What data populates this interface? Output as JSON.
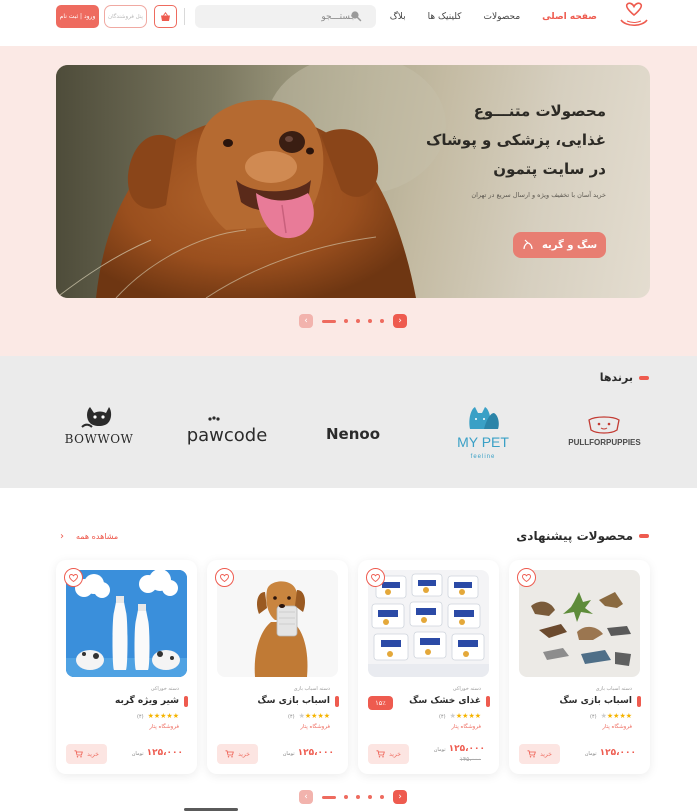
{
  "header": {
    "nav": [
      {
        "label": "صفحه اصلی",
        "active": true
      },
      {
        "label": "محصولات",
        "active": false
      },
      {
        "label": "کلینیک ها",
        "active": false
      },
      {
        "label": "بلاگ",
        "active": false
      }
    ],
    "search_placeholder": "جستـــجو",
    "wallet_label": "پنل فروشندگان",
    "login_label": "ورود | ثبت نام"
  },
  "hero": {
    "title_line1": "محصولات متنـــوع",
    "title_line2": "غذایی، پزشکی و پوشاک",
    "title_line3": "در سایت پتمون",
    "subtitle": "خرید آسان با تخفیف ویژه و ارسال سریع در تهران",
    "button_label": "سگ و گربه"
  },
  "brands": {
    "title": "برندها",
    "items": [
      "PULLFORPUPPIES",
      "MY PET",
      "feeline",
      "Nenoo",
      "pawcode",
      "BOWWOW"
    ]
  },
  "products": {
    "title": "محصولات پیشنهادی",
    "see_all": "مشاهده همه",
    "items": [
      {
        "category": "دسته اسباب بازی",
        "name": "اسباب بازی سگ",
        "rating": 4,
        "reviews": "(۴)",
        "shop": "فروشگاه پتار",
        "price": "۱۲۵،۰۰۰",
        "currency": "تومان",
        "buy": "خرید",
        "old_price": "",
        "discount": ""
      },
      {
        "category": "دسته خوراکی",
        "name": "غذای خشک سگ",
        "rating": 4,
        "reviews": "(۴)",
        "shop": "فروشگاه پتار",
        "price": "۱۲۵،۰۰۰",
        "currency": "تومان",
        "buy": "خرید",
        "old_price": "۱۴۵،۰۰۰",
        "discount": "۱۵٪"
      },
      {
        "category": "دسته اسباب بازی",
        "name": "اسباب بازی سگ",
        "rating": 4,
        "reviews": "(۴)",
        "shop": "فروشگاه پتار",
        "price": "۱۲۵،۰۰۰",
        "currency": "تومان",
        "buy": "خرید",
        "old_price": "",
        "discount": ""
      },
      {
        "category": "دسته خوراکی",
        "name": "شیر ویژه گربه",
        "rating": 5,
        "reviews": "(۴)",
        "shop": "فروشگاه پتار",
        "price": "۱۲۵،۰۰۰",
        "currency": "تومان",
        "buy": "خرید",
        "old_price": "",
        "discount": ""
      }
    ]
  },
  "colors": {
    "accent": "#ee5b4f",
    "hero_bg": "#fbe9e5",
    "brands_bg": "#ebebeb"
  },
  "slider": {
    "pages": 5,
    "active_page": 1
  }
}
